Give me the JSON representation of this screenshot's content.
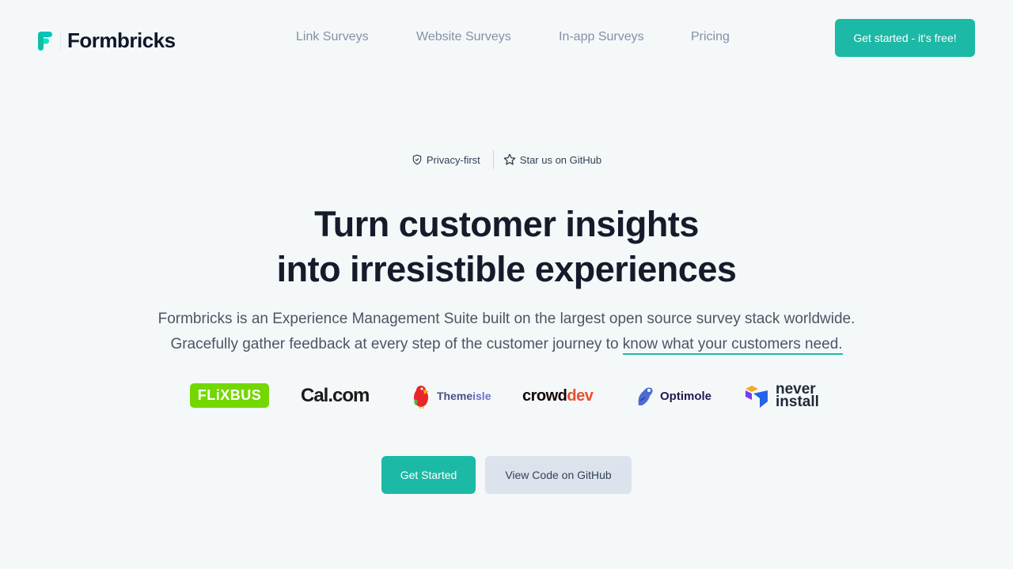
{
  "header": {
    "brand": "Formbricks",
    "nav": [
      {
        "label": "Link Surveys"
      },
      {
        "label": "Website Surveys"
      },
      {
        "label": "In-app Surveys"
      },
      {
        "label": "Pricing"
      }
    ],
    "cta_label": "Get started - it's free!"
  },
  "badges": {
    "privacy": {
      "label": "Privacy-first",
      "icon": "shield-check-icon"
    },
    "github": {
      "label": "Star us on GitHub",
      "icon": "star-icon"
    }
  },
  "hero": {
    "title_line1": "Turn customer insights",
    "title_line2": "into irresistible experiences",
    "subtitle_line1": "Formbricks is an Experience Management Suite built on the largest open source survey stack worldwide.",
    "subtitle_line2_prefix": "Gracefully gather feedback at every step of the customer journey to ",
    "subtitle_highlight": "know what your customers need."
  },
  "customer_logos": {
    "flixbus": "FLiXBUS",
    "calcom": "Cal.com",
    "themeisle": {
      "theme": "Theme",
      "isle": "isle"
    },
    "crowddev": {
      "crowd": "crowd",
      "dev": "dev"
    },
    "optimole": "Optimole",
    "neverinstall": {
      "line1": "never",
      "line2": "install"
    }
  },
  "actions": {
    "primary": "Get Started",
    "secondary": "View Code on GitHub"
  },
  "colors": {
    "accent": "#1cb9a6",
    "background": "#f4f8f9",
    "heading": "#161b2b"
  }
}
